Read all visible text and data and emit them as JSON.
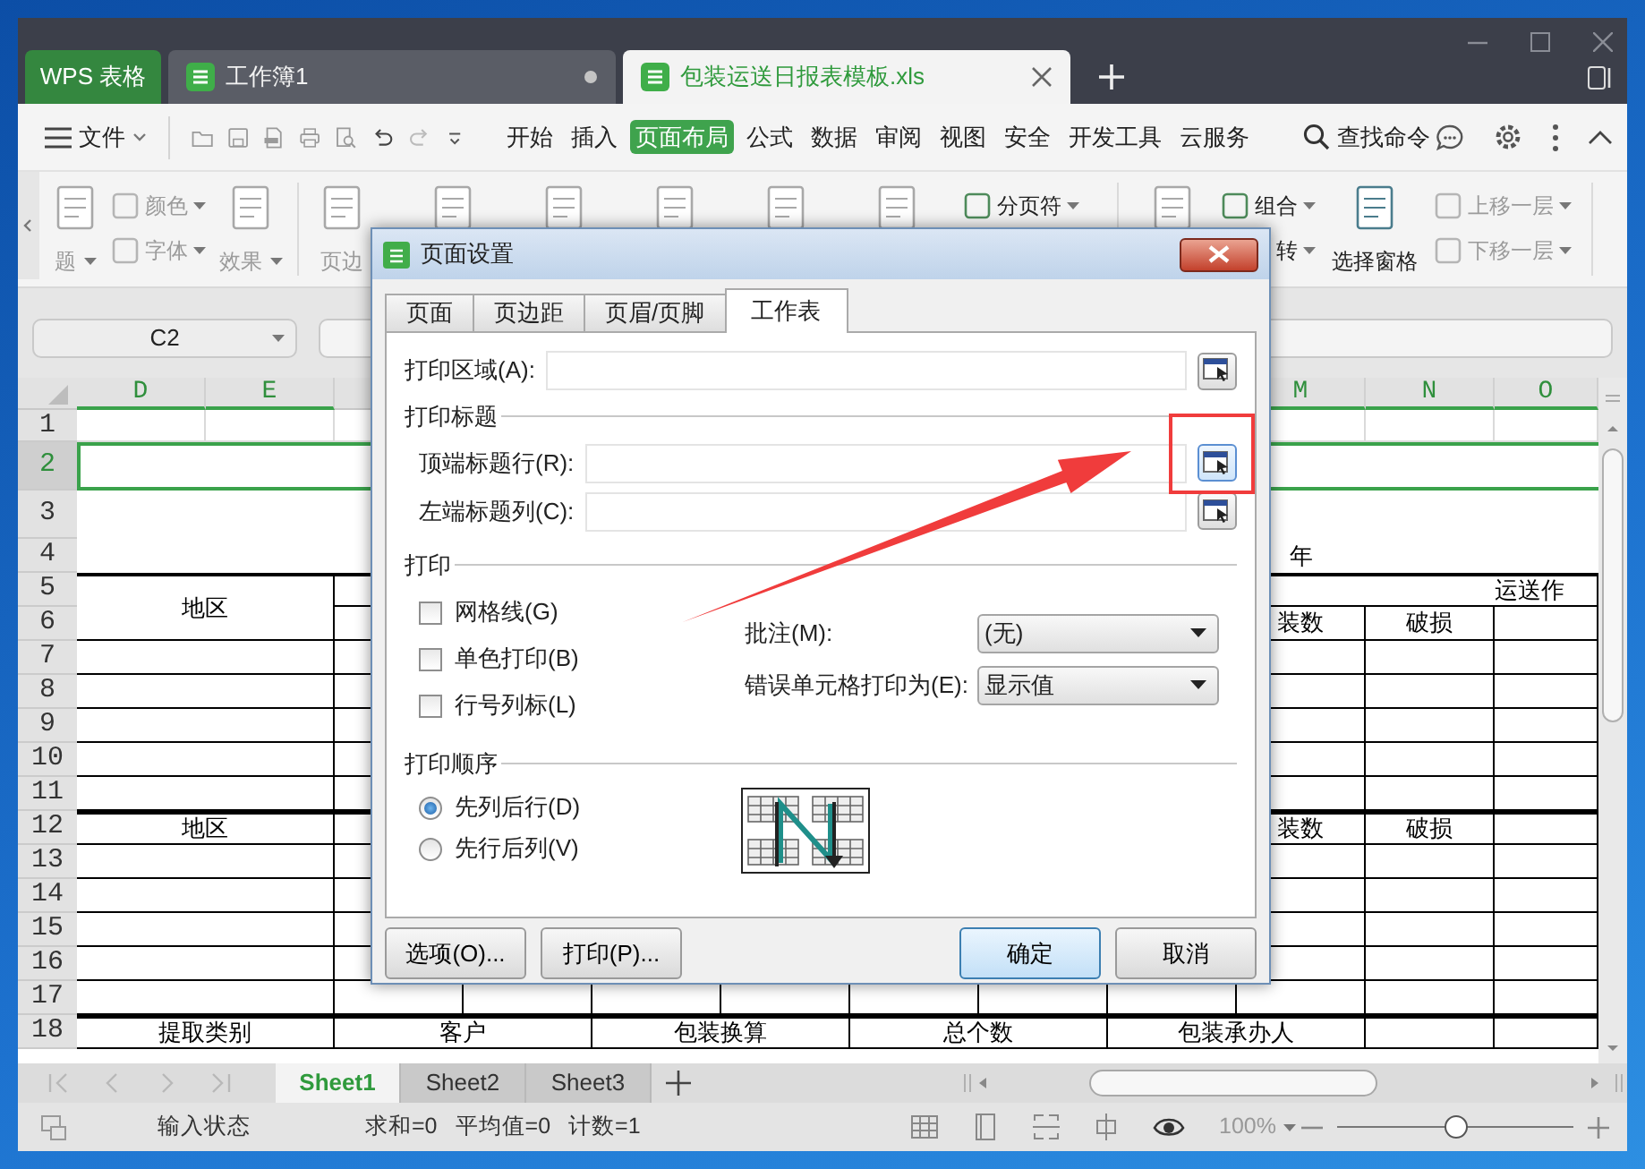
{
  "window": {
    "tabs": [
      {
        "label": "WPS 表格",
        "kind": "home",
        "selected": false
      },
      {
        "label": "工作簿1",
        "kind": "document",
        "selected": false
      },
      {
        "label": "包装运送日报表模板.xls",
        "kind": "document",
        "selected": true
      }
    ]
  },
  "menu_bar": {
    "file_menu": "文件",
    "menus": [
      {
        "label": "开始",
        "selected": false
      },
      {
        "label": "插入",
        "selected": false
      },
      {
        "label": "页面布局",
        "selected": true
      },
      {
        "label": "公式",
        "selected": false
      },
      {
        "label": "数据",
        "selected": false
      },
      {
        "label": "审阅",
        "selected": false
      },
      {
        "label": "视图",
        "selected": false
      },
      {
        "label": "安全",
        "selected": false
      },
      {
        "label": "开发工具",
        "selected": false
      },
      {
        "label": "云服务",
        "selected": false
      }
    ],
    "search": "查找命令"
  },
  "ribbon": {
    "items": [
      {
        "kind": "large",
        "label": "题",
        "caret": true,
        "disabled": true
      },
      {
        "kind": "stack",
        "items": [
          {
            "kind": "icon-text",
            "label": "颜色",
            "caret": true,
            "disabled": true
          },
          {
            "kind": "icon-text",
            "label": "字体",
            "caret": true,
            "disabled": true
          }
        ]
      },
      {
        "kind": "large",
        "label": "效果",
        "caret": true,
        "disabled": true
      },
      {
        "kind": "separator"
      },
      {
        "kind": "large",
        "label": "页边",
        "disabled": true
      },
      {
        "kind": "icon"
      },
      {
        "kind": "icon"
      },
      {
        "kind": "icon"
      },
      {
        "kind": "icon"
      },
      {
        "kind": "icon"
      },
      {
        "kind": "stack",
        "items": [
          {
            "kind": "icon-text",
            "label": "分页符",
            "caret": true,
            "disabled": false
          }
        ]
      },
      {
        "kind": "separator"
      },
      {
        "kind": "icon"
      },
      {
        "kind": "stack",
        "items": [
          {
            "kind": "icon-text",
            "label": "组合",
            "caret": true,
            "disabled": false
          },
          {
            "kind": "text",
            "label": "转",
            "caret": true,
            "disabled": false
          }
        ]
      },
      {
        "kind": "large",
        "label": "选择窗格",
        "disabled": false
      },
      {
        "kind": "stack",
        "items": [
          {
            "kind": "icon-text",
            "label": "上移一层",
            "caret": true,
            "disabled": true
          },
          {
            "kind": "icon-text",
            "label": "下移一层",
            "caret": true,
            "disabled": true
          }
        ]
      },
      {
        "kind": "separator"
      }
    ]
  },
  "name_box": "C2",
  "sheet": {
    "columns": [
      {
        "label": "D",
        "selected": true
      },
      {
        "label": "E",
        "selected": true
      },
      {
        "label": "M",
        "selected": true
      },
      {
        "label": "N",
        "selected": true
      },
      {
        "label": "O",
        "selected": true
      }
    ],
    "rows": [
      {
        "number": "1",
        "kind": "gridlines",
        "selected": false
      },
      {
        "number": "2",
        "kind": "merged",
        "selected": true
      },
      {
        "number": "3",
        "kind": "merged",
        "selected": false
      },
      {
        "number": "4",
        "kind": "merged",
        "selected": false,
        "cells": [
          {
            "text": "年"
          }
        ]
      },
      {
        "number": "5",
        "kind": "ruled",
        "selected": false,
        "thick_top": true,
        "cells": [
          {
            "text": "地区"
          },
          {
            "text": "运送作"
          }
        ]
      },
      {
        "number": "6",
        "kind": "ruled",
        "selected": false,
        "cells": [
          {
            "text": "装数"
          },
          {
            "text": "破损"
          }
        ]
      },
      {
        "number": "7",
        "kind": "ruled",
        "selected": false
      },
      {
        "number": "8",
        "kind": "ruled",
        "selected": false
      },
      {
        "number": "9",
        "kind": "ruled",
        "selected": false
      },
      {
        "number": "10",
        "kind": "ruled",
        "selected": false
      },
      {
        "number": "11",
        "kind": "ruled",
        "selected": false
      },
      {
        "number": "12",
        "kind": "ruled",
        "selected": false,
        "thick_top": true,
        "cells": [
          {
            "text": "地区"
          },
          {
            "text": "装数"
          },
          {
            "text": "破损"
          }
        ]
      },
      {
        "number": "13",
        "kind": "ruled",
        "selected": false
      },
      {
        "number": "14",
        "kind": "ruled",
        "selected": false
      },
      {
        "number": "15",
        "kind": "ruled",
        "selected": false
      },
      {
        "number": "16",
        "kind": "ruled",
        "selected": false
      },
      {
        "number": "17",
        "kind": "ruled",
        "selected": false
      },
      {
        "number": "18",
        "kind": "ruled",
        "selected": false,
        "thick_top": true,
        "cells": [
          {
            "text": "提取类别"
          },
          {
            "text": "客户"
          },
          {
            "text": "包装换算"
          },
          {
            "text": "总个数"
          },
          {
            "text": "包装承办人"
          }
        ]
      }
    ]
  },
  "dialog": {
    "title": "页面设置",
    "tabs": [
      {
        "label": "页面",
        "selected": false
      },
      {
        "label": "页边距",
        "selected": false
      },
      {
        "label": "页眉/页脚",
        "selected": false
      },
      {
        "label": "工作表",
        "selected": true
      }
    ],
    "print_area": {
      "label": "打印区域(A):",
      "hover": false
    },
    "print_titles": {
      "heading": "打印标题",
      "fields": [
        {
          "label": "顶端标题行(R):",
          "hover": true
        },
        {
          "label": "左端标题列(C):",
          "hover": false
        }
      ]
    },
    "print": {
      "heading": "打印",
      "checkboxes": [
        {
          "label": "网格线(G)",
          "checked": false
        },
        {
          "label": "单色打印(B)",
          "checked": false
        },
        {
          "label": "行号列标(L)",
          "checked": false
        }
      ],
      "selects": [
        {
          "label": "批注(M):",
          "value": "(无)"
        },
        {
          "label": "错误单元格打印为(E):",
          "value": "显示值"
        }
      ]
    },
    "print_order": {
      "heading": "打印顺序",
      "options": [
        {
          "label": "先列后行(D)",
          "selected": true
        },
        {
          "label": "先行后列(V)",
          "selected": false
        }
      ]
    },
    "left_buttons": [
      {
        "label": "选项(O)...",
        "default": false
      },
      {
        "label": "打印(P)...",
        "default": false
      }
    ],
    "right_buttons": [
      {
        "label": "确定",
        "default": true
      },
      {
        "label": "取消",
        "default": false
      }
    ]
  },
  "annotations": [
    {
      "kind": "arrow"
    },
    {
      "kind": "frame"
    }
  ],
  "sheet_tabs": [
    {
      "label": "Sheet1",
      "selected": true
    },
    {
      "label": "Sheet2",
      "selected": false
    },
    {
      "label": "Sheet3",
      "selected": false
    }
  ],
  "status_bar": {
    "texts": [
      "输入状态",
      "求和=0",
      "平均值=0",
      "计数=1"
    ],
    "zoom": "100%",
    "zoom_slider": {
      "level": 0.5
    }
  }
}
